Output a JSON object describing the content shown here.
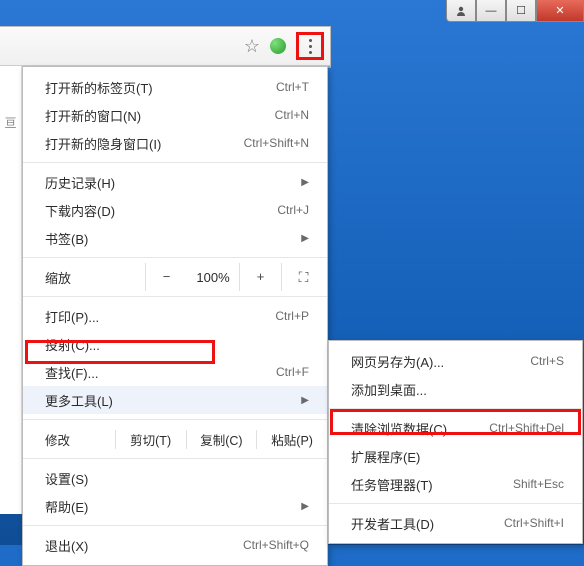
{
  "window_controls": {
    "account": "◘",
    "min": "—",
    "max": "☐",
    "close": "✕"
  },
  "brand_left": "亘",
  "menu": {
    "new_tab": {
      "label": "打开新的标签页(T)",
      "accel": "Ctrl+T"
    },
    "new_window": {
      "label": "打开新的窗口(N)",
      "accel": "Ctrl+N"
    },
    "incognito": {
      "label": "打开新的隐身窗口(I)",
      "accel": "Ctrl+Shift+N"
    },
    "history": {
      "label": "历史记录(H)"
    },
    "downloads": {
      "label": "下载内容(D)",
      "accel": "Ctrl+J"
    },
    "bookmarks": {
      "label": "书签(B)"
    },
    "zoom": {
      "label": "缩放",
      "minus": "−",
      "value": "100%",
      "plus": "+",
      "full": "⛶"
    },
    "print": {
      "label": "打印(P)...",
      "accel": "Ctrl+P"
    },
    "cast": {
      "label": "投射(C)..."
    },
    "find": {
      "label": "查找(F)...",
      "accel": "Ctrl+F"
    },
    "more_tools": {
      "label": "更多工具(L)"
    },
    "edit": {
      "label": "修改",
      "cut": "剪切(T)",
      "copy": "复制(C)",
      "paste": "粘贴(P)"
    },
    "settings": {
      "label": "设置(S)"
    },
    "help": {
      "label": "帮助(E)"
    },
    "exit": {
      "label": "退出(X)",
      "accel": "Ctrl+Shift+Q"
    }
  },
  "submenu": {
    "save_as": {
      "label": "网页另存为(A)...",
      "accel": "Ctrl+S"
    },
    "add_desktop": {
      "label": "添加到桌面..."
    },
    "clear_data": {
      "label": "清除浏览数据(C)...",
      "accel": "Ctrl+Shift+Del"
    },
    "extensions": {
      "label": "扩展程序(E)"
    },
    "task_mgr": {
      "label": "任务管理器(T)",
      "accel": "Shift+Esc"
    },
    "dev_tools": {
      "label": "开发者工具(D)",
      "accel": "Ctrl+Shift+I"
    }
  }
}
